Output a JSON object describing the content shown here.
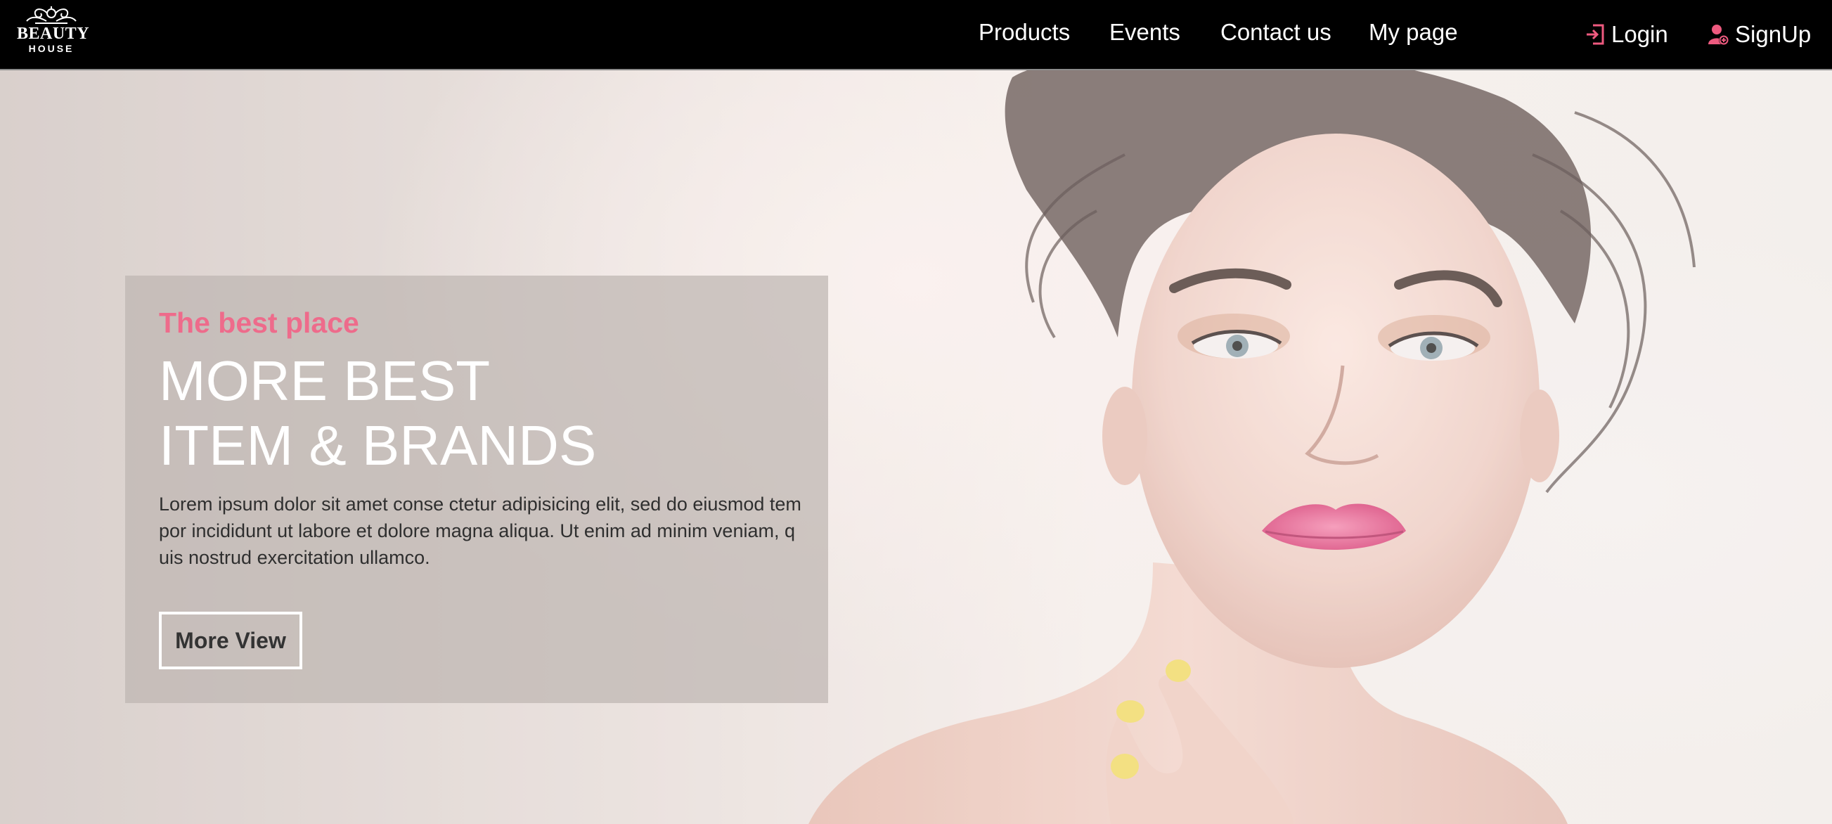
{
  "logo": {
    "line1": "BEAUTY",
    "line2": "HOUSE"
  },
  "nav": {
    "items": [
      {
        "label": "Products"
      },
      {
        "label": "Events"
      },
      {
        "label": "Contact us"
      },
      {
        "label": "My page"
      }
    ],
    "login_label": "Login",
    "signup_label": "SignUp",
    "icon_color": "#ee5a7f"
  },
  "hero": {
    "kicker": "The best place",
    "title_line1": "MORE BEST",
    "title_line2": "ITEM & BRANDS",
    "description": "Lorem ipsum dolor sit amet conse ctetur adipisicing elit, sed do eiusmod tem por incididunt ut labore et dolore magna aliqua. Ut enim ad minim veniam, q uis nostrud exercitation ullamco.",
    "button_label": "More View",
    "accent_color": "#ee6b8b"
  }
}
